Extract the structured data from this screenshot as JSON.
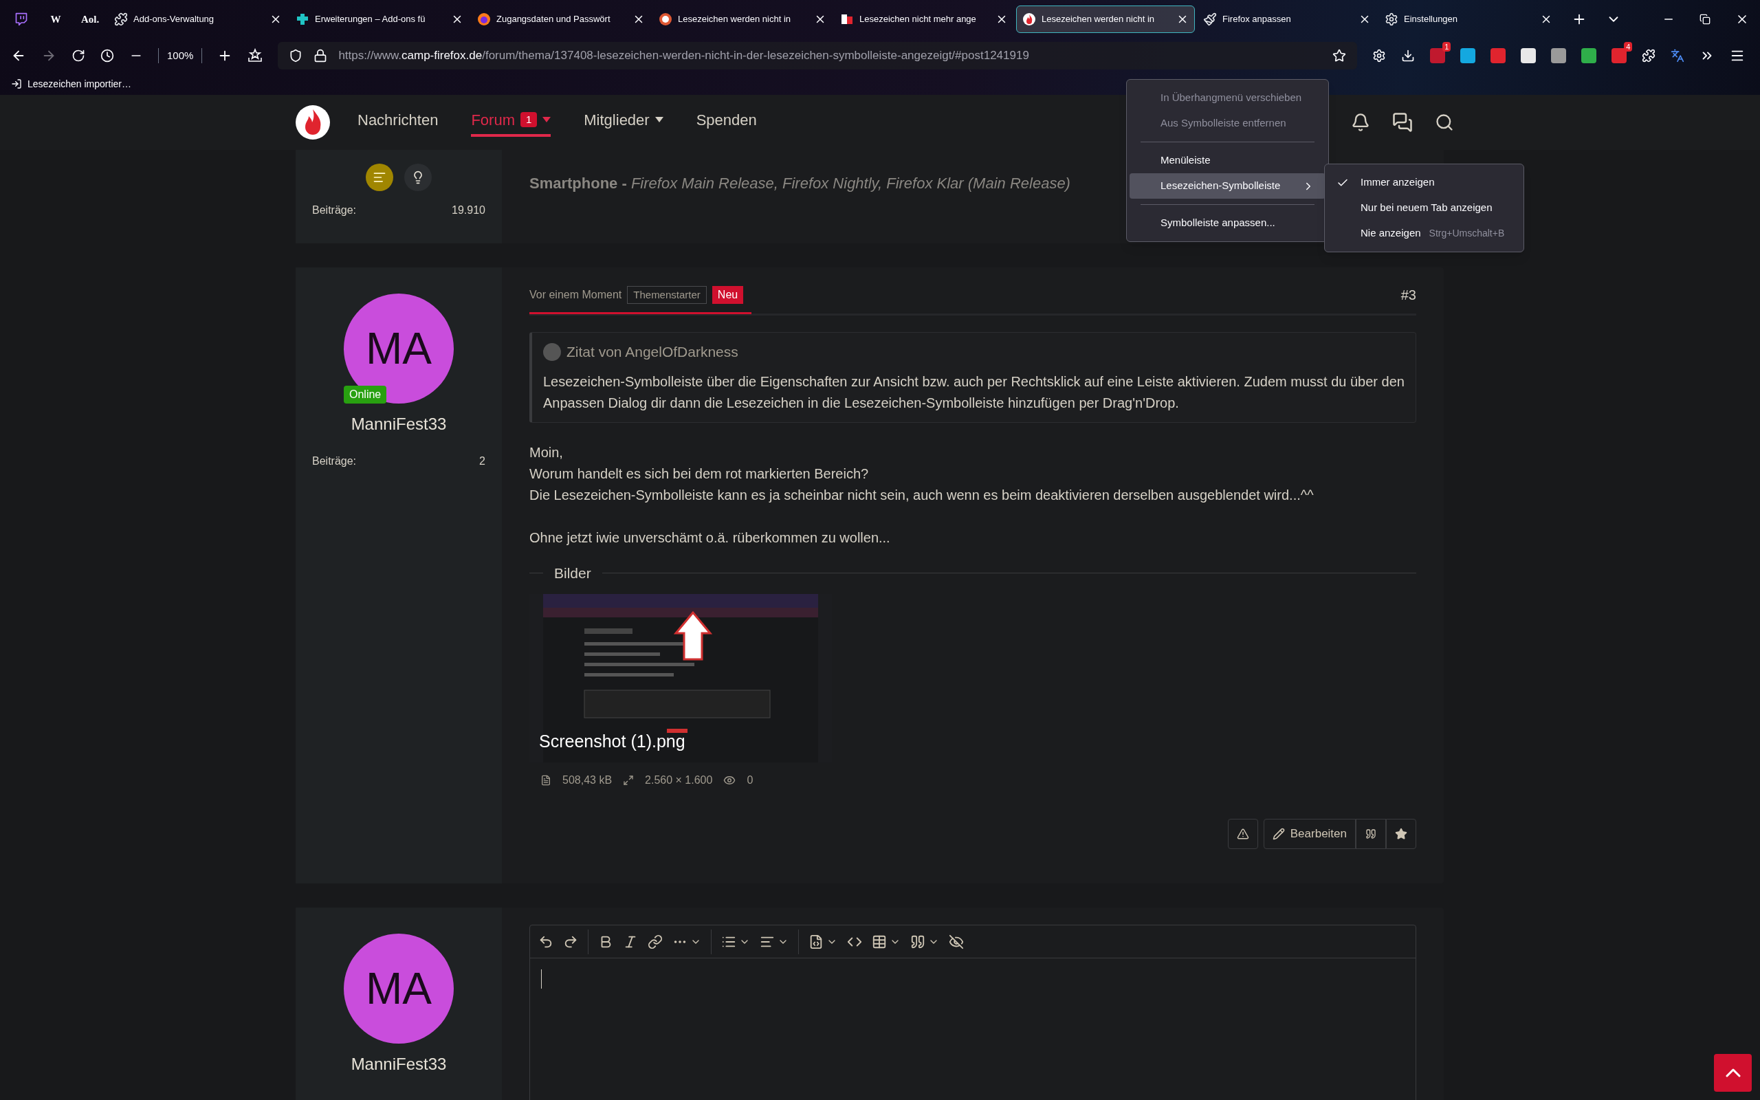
{
  "browser": {
    "pinned_tabs": [
      {
        "kind": "twitch"
      },
      {
        "kind": "glyph",
        "glyph": "W"
      },
      {
        "kind": "glyph",
        "glyph": "Aol."
      }
    ],
    "tabs": [
      {
        "label": "Add-ons-Verwaltung",
        "kind": "puzzle",
        "selected": false
      },
      {
        "label": "Erweiterungen – Add-ons fü",
        "kind": "addons",
        "selected": false
      },
      {
        "label": "Zugangsdaten und Passwört",
        "kind": "firefox",
        "selected": false
      },
      {
        "label": "Lesezeichen werden nicht in",
        "kind": "duck",
        "selected": false
      },
      {
        "label": "Lesezeichen nicht mehr ange",
        "kind": "cb",
        "selected": false
      },
      {
        "label": "Lesezeichen werden nicht in",
        "kind": "camp",
        "selected": true
      },
      {
        "label": "Firefox anpassen",
        "kind": "brush",
        "selected": false
      },
      {
        "label": "Einstellungen",
        "kind": "gear",
        "selected": false
      }
    ],
    "zoom": "100%",
    "url_prefix": "https://www.",
    "url_domain": "camp-firefox.de",
    "url_path": "/forum/thema/137408-lesezeichen-werden-nicht-in-der-lesezeichen-symbolleiste-angezeigt/#post1241919",
    "extensions": [
      {
        "color": "#c0192e",
        "badge": "1"
      },
      {
        "color": "#14a8e0"
      },
      {
        "color": "#e0242e"
      },
      {
        "color": "#e8e8e8"
      },
      {
        "color": "#9a9a9a"
      },
      {
        "color": "#2fae4a"
      },
      {
        "color": "#e0242e",
        "badge": "4"
      }
    ],
    "bookmark": "Lesezeichen importier…"
  },
  "site_nav": {
    "items": [
      {
        "label": "Nachrichten",
        "selected": false,
        "caret": false
      },
      {
        "label": "Forum",
        "selected": true,
        "badge": "1",
        "caret": true
      },
      {
        "label": "Mitglieder",
        "selected": false,
        "caret": true
      },
      {
        "label": "Spenden",
        "selected": false,
        "caret": false
      }
    ]
  },
  "post_previous": {
    "signature": "**Smartphone -** *Firefox Main Release, Firefox Nightly, Firefox Klar (Main Release)*",
    "stats_label": "Beiträge:",
    "stats_value": "19.910"
  },
  "post": {
    "time": "Vor einem Moment",
    "starter_badge": "Themenstarter",
    "new_badge": "Neu",
    "number": "#3",
    "avatar": "MA",
    "online": "Online",
    "user": "ManniFest33",
    "stats_label": "Beiträge:",
    "stats_value": "2",
    "quote": {
      "author": "Zitat von AngelOfDarkness",
      "text": "Lesezeichen-Symbolleiste über die Eigenschaften zur Ansicht bzw. auch per Rechtsklick auf eine Leiste aktivieren. Zudem musst du über den Anpassen Dialog dir dann die Lesezeichen in die Lesezeichen-Symbolleiste hinzufügen per Drag'n'Drop."
    },
    "paragraphs": [
      [
        "Moin,",
        "Worum handelt es sich bei dem rot markierten Bereich?",
        "Die Lesezeichen-Symbolleiste kann es ja scheinbar nicht sein, auch wenn es beim deaktivieren derselben ausgeblendet wird...^^"
      ],
      [
        "Ohne jetzt iwie unverschämt o.ä. rüberkommen zu wollen..."
      ]
    ],
    "images_heading": "Bilder",
    "attachment": {
      "kind": "picture",
      "name": "Screenshot (1).png",
      "size": "508,43 kB",
      "dimensions": "2.560 × 1.600",
      "views": "0"
    },
    "actions": [
      {
        "kind": "report"
      },
      {
        "kind": "edit",
        "label": "Bearbeiten"
      },
      {
        "kind": "quote"
      },
      {
        "kind": "star"
      }
    ]
  },
  "reply": {
    "avatar": "MA",
    "user": "ManniFest33"
  },
  "context_menu": {
    "items": [
      {
        "kind": "item",
        "label": "In Überhangmenü verschieben",
        "disabled": true,
        "highlighted": false
      },
      {
        "kind": "item",
        "label": "Aus Symbolleiste entfernen",
        "disabled": true,
        "highlighted": false
      },
      {
        "kind": "separator"
      },
      {
        "kind": "item",
        "label": "Menüleiste",
        "disabled": false,
        "highlighted": false
      },
      {
        "kind": "submenu",
        "label": "Lesezeichen-Symbolleiste",
        "disabled": false,
        "highlighted": true
      },
      {
        "kind": "separator"
      },
      {
        "kind": "item",
        "label": "Symbolleiste anpassen...",
        "disabled": false,
        "highlighted": false
      }
    ],
    "submenu": [
      {
        "label": "Immer anzeigen",
        "checked": true
      },
      {
        "label": "Nur bei neuem Tab anzeigen",
        "checked": false
      },
      {
        "label": "Nie anzeigen",
        "checked": false,
        "shortcut": "Strg+Umschalt+B"
      }
    ]
  }
}
